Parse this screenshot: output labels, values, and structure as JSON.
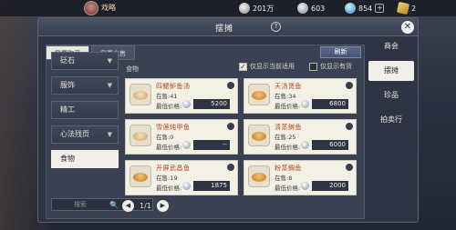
{
  "topbar": {
    "player_name": "戏略",
    "currencies": [
      {
        "icon": "coin-icon",
        "value": "201万"
      },
      {
        "icon": "silver-icon",
        "value": "603"
      },
      {
        "icon": "jade-icon",
        "value": "854"
      },
      {
        "icon": "token-icon",
        "value": "2"
      }
    ]
  },
  "panel": {
    "title": "摆摊",
    "help_symbol": "?",
    "close_symbol": "✕"
  },
  "tabs": [
    {
      "label": "我要购买",
      "active": true
    },
    {
      "label": "我要出售",
      "active": false
    }
  ],
  "refresh_label": "刷新",
  "categories": [
    {
      "label": "砭石",
      "arrow": "▼"
    },
    {
      "label": "服饰",
      "arrow": "▼"
    },
    {
      "label": "精工",
      "arrow": ""
    },
    {
      "label": "心法残页",
      "arrow": "▼"
    },
    {
      "label": "食物",
      "arrow": "",
      "active": true
    }
  ],
  "section_label": "食物",
  "filters": [
    {
      "label": "仅显示当前适用",
      "checked": true,
      "mark": "✓"
    },
    {
      "label": "仅显示有货",
      "checked": false,
      "mark": ""
    }
  ],
  "items": [
    {
      "name": "四鳃鲈鱼汤",
      "stock": "在售:41",
      "price_label": "最低价格:",
      "price": "5200"
    },
    {
      "name": "天汤煲鱼",
      "stock": "在售:34",
      "price_label": "最低价格:",
      "price": "6800"
    },
    {
      "name": "雪莲炖甲鱼",
      "stock": "在售:0",
      "price_label": "最低价格:",
      "price": "--"
    },
    {
      "name": "清蒸鲥鱼",
      "stock": "在售:25",
      "price_label": "最低价格:",
      "price": "6000"
    },
    {
      "name": "开屏武昌鱼",
      "stock": "在售:19",
      "price_label": "最低价格:",
      "price": "1875"
    },
    {
      "name": "粉蒸鲷鱼",
      "stock": "在售:8",
      "price_label": "最低价格:",
      "price": "2000"
    }
  ],
  "search": {
    "placeholder": "搜索"
  },
  "pager": {
    "prev": "◀",
    "page": "1/1",
    "next": "▶"
  },
  "right_tabs": [
    {
      "label": "商会",
      "active": false
    },
    {
      "label": "摆摊",
      "active": true
    },
    {
      "label": "珍品",
      "active": false
    },
    {
      "label": "拍卖行",
      "active": false
    }
  ]
}
